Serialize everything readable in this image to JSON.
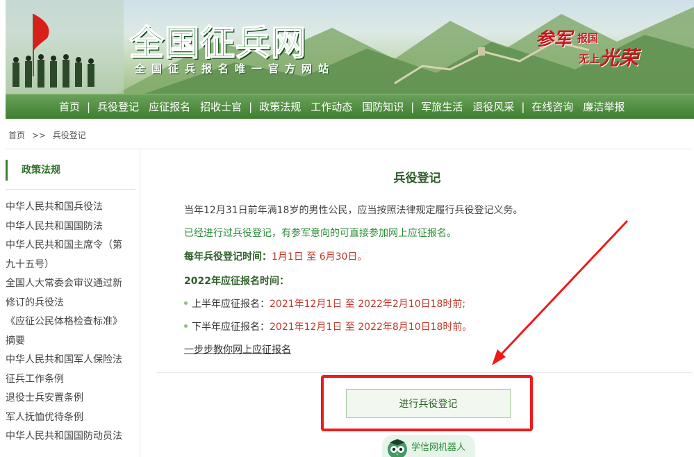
{
  "site": {
    "logo_text": "全国征兵网",
    "subtitle": "全国征兵报名唯一官方网站",
    "slogan": {
      "part1": "参军",
      "part2": "报国",
      "part3": "无上",
      "part4": "光荣"
    }
  },
  "nav": {
    "items": [
      "首页",
      "兵役登记",
      "应征报名",
      "招收士官",
      "政策法规",
      "工作动态",
      "国防知识",
      "军旅生活",
      "退役风采",
      "在线咨询",
      "廉洁举报"
    ],
    "separator": "|"
  },
  "breadcrumb": {
    "home": "首页",
    "sep": ">>",
    "current": "兵役登记"
  },
  "sidebar": {
    "heading": "政策法规",
    "links": [
      "中华人民共和国兵役法",
      "中华人民共和国国防法",
      "中华人民共和国主席令（第",
      "九十五号）",
      "全国人大常委会审议通过新",
      "修订的兵役法",
      "《应征公民体格检查标准》",
      "摘要",
      "中华人民共和国军人保险法",
      "征兵工作条例",
      "退役士兵安置条例",
      "军人抚恤优待条例",
      "中华人民共和国国防动员法"
    ]
  },
  "content": {
    "title": "兵役登记",
    "p1": "当年12月31日前年满18岁的男性公民，应当按照法律规定履行兵役登记义务。",
    "p2": "已经进行过兵役登记，有参军意向的可直接参加网上应征报名。",
    "registration_label": "每年兵役登记时间：",
    "registration_value": "1月1日 至 6月30日。",
    "enlist_heading": "2022年应征报名时间：",
    "first_half_label": "上半年应征报名：",
    "first_half_value": "2021年12月1日 至 2022年2月10日18时前;",
    "second_half_label": "下半年应征报名：",
    "second_half_value": "2021年12月1日 至 2022年8月10日18时前。",
    "guide_link": "一步步教你网上应征报名",
    "register_button": "进行兵役登记",
    "robot_label": "学信网机器人"
  },
  "colors": {
    "nav_green": "#4a8a3a",
    "title_green": "#2f5f2a",
    "link_green": "#2e8b3a",
    "date_red": "#c0392b",
    "annotation_red": "#ef1a1a"
  }
}
